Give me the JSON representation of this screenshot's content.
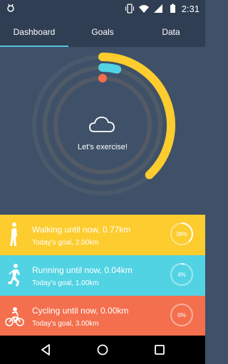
{
  "status_bar": {
    "time": "2:31",
    "icons": [
      "vibrate-icon",
      "wifi-icon",
      "signal-icon",
      "battery-icon"
    ]
  },
  "tabs": [
    {
      "label": "Dashboard",
      "active": true
    },
    {
      "label": "Goals",
      "active": false
    },
    {
      "label": "Data",
      "active": false
    }
  ],
  "dashboard": {
    "message": "Let's exercise!",
    "icon": "cloud-icon",
    "ring_progress": {
      "walking": 0.38,
      "running": 0.04,
      "cycling": 0.0
    }
  },
  "activities": [
    {
      "id": "walking",
      "title": "Walking until now, 0.77km",
      "goal": "Today's goal, 2.00km",
      "percent": "38%",
      "fraction": 0.38,
      "color": "#fdcc2e",
      "icon": "walking-icon"
    },
    {
      "id": "running",
      "title": "Running until now, 0.04km",
      "goal": "Today's goal, 1.00km",
      "percent": "4%",
      "fraction": 0.04,
      "color": "#52d3e3",
      "icon": "running-icon"
    },
    {
      "id": "cycling",
      "title": "Cycling until now, 0.00km",
      "goal": "Today's goal, 3.00km",
      "percent": "0%",
      "fraction": 0.0,
      "color": "#f36f4e",
      "icon": "cycling-icon"
    }
  ],
  "colors": {
    "background": "#3f5168",
    "header": "#2f3e52",
    "accent": "#4fc6e0",
    "walking": "#fdcc2e",
    "running": "#52d3e3",
    "cycling": "#f36f4e"
  },
  "nav": [
    "back-icon",
    "home-icon",
    "recents-icon"
  ]
}
